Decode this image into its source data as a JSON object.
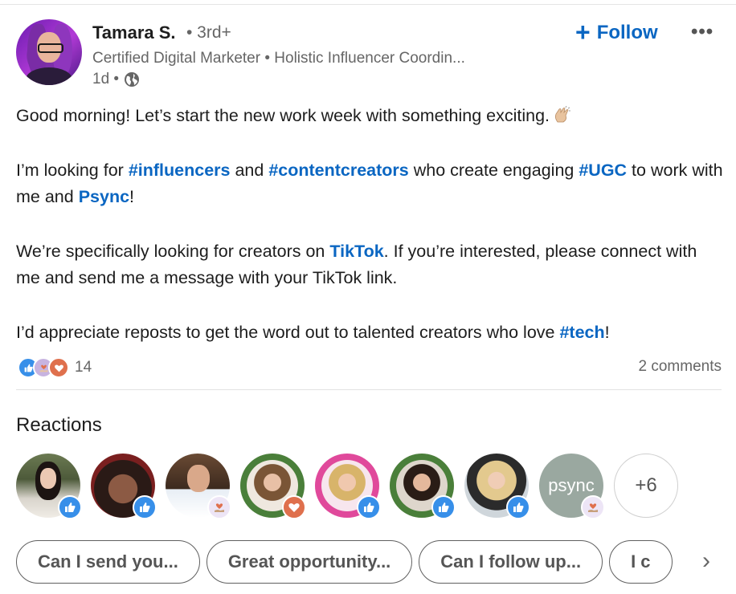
{
  "author": {
    "name": "Tamara S.",
    "degree": "• 3rd+",
    "headline": "Certified Digital Marketer • Holistic Influencer Coordin...",
    "time": "1d •",
    "follow_label": "Follow",
    "more_label": "•••"
  },
  "post": {
    "p1": "Good morning! Let’s start the new work week with something exciting.",
    "p2_a": "I’m looking for ",
    "p2_tag1": "#influencers",
    "p2_b": " and ",
    "p2_tag2": "#contentcreators",
    "p2_c": " who create engaging ",
    "p2_tag3": "#UGC",
    "p2_d": " to work with me and ",
    "p2_mention": "Psync",
    "p2_e": "!",
    "p3_a": "We’re specifically looking for creators on ",
    "p3_mention": "TikTok",
    "p3_b": ". If you’re interested, please connect with me and send me a message with your TikTok link.",
    "p4_a": "I’d appreciate reposts to get the word out to talented creators who love ",
    "p4_tag": "#tech",
    "p4_b": "!"
  },
  "social": {
    "reaction_count": "14",
    "comments": "2 comments"
  },
  "reactions": {
    "title": "Reactions",
    "more_count": "+6",
    "psync_label": "psync",
    "people": [
      {
        "badge": "like"
      },
      {
        "badge": "like"
      },
      {
        "badge": "support"
      },
      {
        "badge": "love"
      },
      {
        "badge": "like"
      },
      {
        "badge": "like"
      },
      {
        "badge": "like"
      },
      {
        "badge": "support"
      }
    ]
  },
  "suggested_replies": [
    "Can I send you...",
    "Great opportunity...",
    "Can I follow up...",
    "I c"
  ],
  "colors": {
    "link_blue": "#0a66c2",
    "like_blue": "#378fe9",
    "love_orange": "#df704d"
  }
}
